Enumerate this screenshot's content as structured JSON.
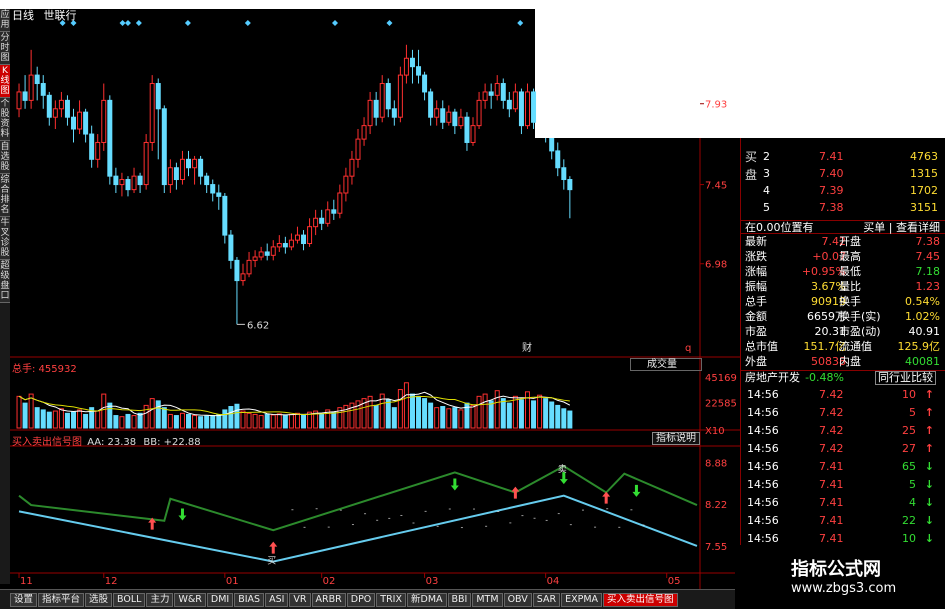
{
  "header": {
    "period": "日线",
    "stock": "世联行"
  },
  "left_tabs": [
    {
      "label": "应用",
      "active": false
    },
    {
      "label": "分时图",
      "active": false
    },
    {
      "label": "K线图",
      "active": true
    },
    {
      "label": "个股资料",
      "active": false
    },
    {
      "label": "自选股",
      "active": false
    },
    {
      "label": "综合排名",
      "active": false
    },
    {
      "label": "牛叉诊股",
      "active": false
    },
    {
      "label": "超级盘口",
      "active": false
    }
  ],
  "price_axis": [
    "7.93",
    "7.45",
    "6.98"
  ],
  "low_marker": "6.62",
  "cai_marker": "财",
  "q_marker": "q",
  "volume": {
    "label": "总手: 455932",
    "dropdown": "成交量",
    "axis": [
      "45169",
      "22585"
    ],
    "unit": "X10"
  },
  "indicator": {
    "title": "买入卖出信号图",
    "aa": "AA: 23.38",
    "bb": "BB: +22.88",
    "button": "指标说明",
    "axis": [
      "8.88",
      "8.22",
      "7.55"
    ],
    "buy_label": "买",
    "sell_label": "卖"
  },
  "date_axis": [
    "11",
    "12",
    "01",
    "02",
    "03",
    "04",
    "05"
  ],
  "bottom_tabs": [
    {
      "label": "设置",
      "active": false
    },
    {
      "label": "指标平台",
      "active": false
    },
    {
      "label": "选股",
      "active": false
    },
    {
      "label": "BOLL",
      "active": false
    },
    {
      "label": "主力",
      "active": false
    },
    {
      "label": "W&R",
      "active": false
    },
    {
      "label": "DMI",
      "active": false
    },
    {
      "label": "BIAS",
      "active": false
    },
    {
      "label": "ASI",
      "active": false
    },
    {
      "label": "VR",
      "active": false
    },
    {
      "label": "ARBR",
      "active": false
    },
    {
      "label": "DPO",
      "active": false
    },
    {
      "label": "TRIX",
      "active": false
    },
    {
      "label": "新DMA",
      "active": false
    },
    {
      "label": "BBI",
      "active": false
    },
    {
      "label": "MTM",
      "active": false
    },
    {
      "label": "OBV",
      "active": false
    },
    {
      "label": "SAR",
      "active": false
    },
    {
      "label": "EXPMA",
      "active": false
    },
    {
      "label": "买入卖出信号图",
      "active": true
    }
  ],
  "order_book": {
    "side_label": "买盘",
    "rows": [
      {
        "lvl": "2",
        "price": "7.41",
        "vol": "4763"
      },
      {
        "lvl": "3",
        "price": "7.40",
        "vol": "1315"
      },
      {
        "lvl": "4",
        "price": "7.39",
        "vol": "1702"
      },
      {
        "lvl": "5",
        "price": "7.38",
        "vol": "3151"
      }
    ]
  },
  "position": {
    "left": "在0.00位置有",
    "right": "买单 | 查看详细"
  },
  "quote": [
    {
      "l1": "最新",
      "v1": "7.42",
      "l2": "开盘",
      "v2": "7.38",
      "c1": "red",
      "c2": "red"
    },
    {
      "l1": "涨跌",
      "v1": "+0.07",
      "l2": "最高",
      "v2": "7.45",
      "c1": "red",
      "c2": "red"
    },
    {
      "l1": "涨幅",
      "v1": "+0.95%",
      "l2": "最低",
      "v2": "7.18",
      "c1": "red",
      "c2": "green"
    },
    {
      "l1": "振幅",
      "v1": "3.67%",
      "l2": "量比",
      "v2": "1.23",
      "c1": "yellow",
      "c2": "red"
    },
    {
      "l1": "总手",
      "v1": "90919",
      "l2": "换手",
      "v2": "0.54%",
      "c1": "yellow",
      "c2": "yellow"
    },
    {
      "l1": "金额",
      "v1": "6659万",
      "l2": "换手(实)",
      "v2": "1.02%",
      "c1": "white",
      "c2": "yellow"
    },
    {
      "l1": "市盈",
      "v1": "20.31",
      "l2": "市盈(动)",
      "v2": "40.91",
      "c1": "white",
      "c2": "white"
    },
    {
      "l1": "总市值",
      "v1": "151.7亿",
      "l2": "流通值",
      "v2": "125.9亿",
      "c1": "yellow",
      "c2": "yellow"
    },
    {
      "l1": "外盘",
      "v1": "50838",
      "l2": "内盘",
      "v2": "40081",
      "c1": "red",
      "c2": "green"
    }
  ],
  "industry": {
    "name": "房地产开发",
    "change": "-0.48%",
    "button": "同行业比较"
  },
  "ticks": [
    {
      "t": "14:56",
      "p": "7.42",
      "v": "10",
      "d": "up"
    },
    {
      "t": "14:56",
      "p": "7.42",
      "v": "5",
      "d": "up"
    },
    {
      "t": "14:56",
      "p": "7.42",
      "v": "25",
      "d": "up"
    },
    {
      "t": "14:56",
      "p": "7.42",
      "v": "27",
      "d": "up"
    },
    {
      "t": "14:56",
      "p": "7.41",
      "v": "65",
      "d": "down"
    },
    {
      "t": "14:56",
      "p": "7.41",
      "v": "5",
      "d": "down"
    },
    {
      "t": "14:56",
      "p": "7.41",
      "v": "4",
      "d": "down"
    },
    {
      "t": "14:56",
      "p": "7.41",
      "v": "22",
      "d": "down"
    },
    {
      "t": "14:56",
      "p": "7.41",
      "v": "10",
      "d": "down"
    }
  ],
  "watermark": {
    "title": "指标公式网",
    "url": "www.zbgs3.com"
  },
  "chart_data": {
    "type": "candlestick",
    "ylim": [
      6.45,
      8.35
    ],
    "candles": [
      [
        7.9,
        8.0,
        8.05,
        7.85
      ],
      [
        8.0,
        7.95,
        8.1,
        7.9
      ],
      [
        7.95,
        8.1,
        8.25,
        7.9
      ],
      [
        8.1,
        8.05,
        8.15,
        7.95
      ],
      [
        8.05,
        7.98,
        8.1,
        7.9
      ],
      [
        7.98,
        7.85,
        8.0,
        7.8
      ],
      [
        7.85,
        7.9,
        7.95,
        7.78
      ],
      [
        7.9,
        7.95,
        8.0,
        7.85
      ],
      [
        7.95,
        7.85,
        7.98,
        7.8
      ],
      [
        7.85,
        7.78,
        7.9,
        7.7
      ],
      [
        7.78,
        7.88,
        7.95,
        7.75
      ],
      [
        7.88,
        7.75,
        7.9,
        7.7
      ],
      [
        7.75,
        7.6,
        7.8,
        7.55
      ],
      [
        7.6,
        7.7,
        7.75,
        7.55
      ],
      [
        7.7,
        7.95,
        8.05,
        7.65
      ],
      [
        7.95,
        7.5,
        7.98,
        7.45
      ],
      [
        7.5,
        7.45,
        7.55,
        7.4
      ],
      [
        7.45,
        7.48,
        7.52,
        7.38
      ],
      [
        7.48,
        7.42,
        7.5,
        7.38
      ],
      [
        7.42,
        7.5,
        7.55,
        7.4
      ],
      [
        7.5,
        7.45,
        7.52,
        7.4
      ],
      [
        7.45,
        7.7,
        7.75,
        7.42
      ],
      [
        7.7,
        8.05,
        8.1,
        7.65
      ],
      [
        8.05,
        7.9,
        8.08,
        7.6
      ],
      [
        7.9,
        7.45,
        7.92,
        7.4
      ],
      [
        7.45,
        7.55,
        7.6,
        7.4
      ],
      [
        7.55,
        7.48,
        7.58,
        7.42
      ],
      [
        7.48,
        7.6,
        7.65,
        7.45
      ],
      [
        7.6,
        7.55,
        7.65,
        7.5
      ],
      [
        7.55,
        7.6,
        7.62,
        7.45
      ],
      [
        7.6,
        7.5,
        7.62,
        7.45
      ],
      [
        7.5,
        7.45,
        7.52,
        7.4
      ],
      [
        7.45,
        7.4,
        7.48,
        7.35
      ],
      [
        7.4,
        7.38,
        7.45,
        7.3
      ],
      [
        7.38,
        7.15,
        7.4,
        7.1
      ],
      [
        7.15,
        7.0,
        7.18,
        6.95
      ],
      [
        7.0,
        6.88,
        7.02,
        6.62
      ],
      [
        6.88,
        6.92,
        6.98,
        6.85
      ],
      [
        6.92,
        7.0,
        7.05,
        6.9
      ],
      [
        7.0,
        7.02,
        7.06,
        6.96
      ],
      [
        7.02,
        7.05,
        7.08,
        7.0
      ],
      [
        7.05,
        7.03,
        7.1,
        7.0
      ],
      [
        7.03,
        7.08,
        7.12,
        7.0
      ],
      [
        7.08,
        7.1,
        7.15,
        7.05
      ],
      [
        7.1,
        7.08,
        7.14,
        7.04
      ],
      [
        7.08,
        7.12,
        7.16,
        7.06
      ],
      [
        7.12,
        7.15,
        7.2,
        7.1
      ],
      [
        7.15,
        7.1,
        7.18,
        7.06
      ],
      [
        7.1,
        7.2,
        7.25,
        7.08
      ],
      [
        7.2,
        7.25,
        7.3,
        7.15
      ],
      [
        7.25,
        7.22,
        7.3,
        7.18
      ],
      [
        7.22,
        7.3,
        7.35,
        7.2
      ],
      [
        7.3,
        7.28,
        7.36,
        7.24
      ],
      [
        7.28,
        7.4,
        7.45,
        7.25
      ],
      [
        7.4,
        7.5,
        7.55,
        7.35
      ],
      [
        7.5,
        7.6,
        7.65,
        7.45
      ],
      [
        7.6,
        7.72,
        7.78,
        7.55
      ],
      [
        7.72,
        7.8,
        7.85,
        7.68
      ],
      [
        7.8,
        7.95,
        8.0,
        7.75
      ],
      [
        7.95,
        7.85,
        8.0,
        7.8
      ],
      [
        7.85,
        8.05,
        8.1,
        7.82
      ],
      [
        8.05,
        7.9,
        8.08,
        7.85
      ],
      [
        7.9,
        7.85,
        7.95,
        7.8
      ],
      [
        7.85,
        8.1,
        8.15,
        7.82
      ],
      [
        8.1,
        8.2,
        8.28,
        8.05
      ],
      [
        8.2,
        8.15,
        8.25,
        8.05
      ],
      [
        8.15,
        8.1,
        8.25,
        8.05
      ],
      [
        8.1,
        8.0,
        8.12,
        7.95
      ],
      [
        8.0,
        7.85,
        8.02,
        7.8
      ],
      [
        7.85,
        7.9,
        7.95,
        7.8
      ],
      [
        7.9,
        7.82,
        7.95,
        7.78
      ],
      [
        7.82,
        7.88,
        7.92,
        7.8
      ],
      [
        7.88,
        7.8,
        7.9,
        7.75
      ],
      [
        7.8,
        7.85,
        7.9,
        7.78
      ],
      [
        7.85,
        7.7,
        7.88,
        7.65
      ],
      [
        7.7,
        7.8,
        7.85,
        7.68
      ],
      [
        7.8,
        7.95,
        8.0,
        7.78
      ],
      [
        7.95,
        8.0,
        8.05,
        7.9
      ],
      [
        8.0,
        7.98,
        8.05,
        7.9
      ],
      [
        7.98,
        8.05,
        8.1,
        7.95
      ],
      [
        8.05,
        7.95,
        8.08,
        7.9
      ],
      [
        7.95,
        7.9,
        8.0,
        7.85
      ],
      [
        7.9,
        8.0,
        8.05,
        7.88
      ],
      [
        8.0,
        7.8,
        8.02,
        7.75
      ],
      [
        7.8,
        8.0,
        8.05,
        7.78
      ],
      [
        8.0,
        7.82,
        8.02,
        7.78
      ],
      [
        7.82,
        7.95,
        8.0,
        7.8
      ],
      [
        7.95,
        7.75,
        7.98,
        7.7
      ],
      [
        7.75,
        7.65,
        7.8,
        7.6
      ],
      [
        7.65,
        7.55,
        7.7,
        7.5
      ],
      [
        7.55,
        7.48,
        7.6,
        7.42
      ],
      [
        7.48,
        7.42,
        7.5,
        7.25
      ]
    ],
    "volume": [
      28000,
      22000,
      30000,
      18000,
      16000,
      14000,
      15000,
      17000,
      13000,
      14000,
      16000,
      12000,
      18000,
      15000,
      30000,
      22000,
      11000,
      10000,
      12000,
      11000,
      13000,
      20000,
      26000,
      24000,
      18000,
      12000,
      11000,
      13000,
      12000,
      11000,
      10000,
      10500,
      11000,
      12000,
      16000,
      19000,
      21000,
      15000,
      13000,
      12000,
      11000,
      12000,
      11500,
      12500,
      11000,
      12000,
      13000,
      11500,
      14000,
      15000,
      13000,
      16000,
      14000,
      18000,
      20000,
      22000,
      24000,
      26000,
      28000,
      20000,
      30000,
      25000,
      18000,
      34000,
      40000,
      30000,
      28000,
      26000,
      22000,
      18000,
      19000,
      17000,
      18000,
      16000,
      22000,
      20000,
      28000,
      30000,
      24000,
      33000,
      26000,
      22000,
      28000,
      25000,
      32000,
      24000,
      29000,
      26000,
      23000,
      20000,
      17000,
      15000
    ],
    "signal_green": [
      [
        0,
        8.35
      ],
      [
        2,
        8.2
      ],
      [
        24,
        7.95
      ],
      [
        25,
        8.3
      ],
      [
        42,
        7.8
      ],
      [
        72,
        8.72
      ],
      [
        82,
        8.4
      ],
      [
        90,
        8.82
      ],
      [
        97,
        8.4
      ],
      [
        100,
        8.7
      ],
      [
        112,
        8.2
      ]
    ],
    "signal_cyan": [
      [
        0,
        8.1
      ],
      [
        42,
        7.3
      ],
      [
        90,
        8.35
      ],
      [
        112,
        7.55
      ]
    ],
    "buy_signals": [
      22,
      42,
      82,
      97
    ],
    "sell_signals": [
      27,
      72,
      90,
      102
    ],
    "n_days": 113
  }
}
